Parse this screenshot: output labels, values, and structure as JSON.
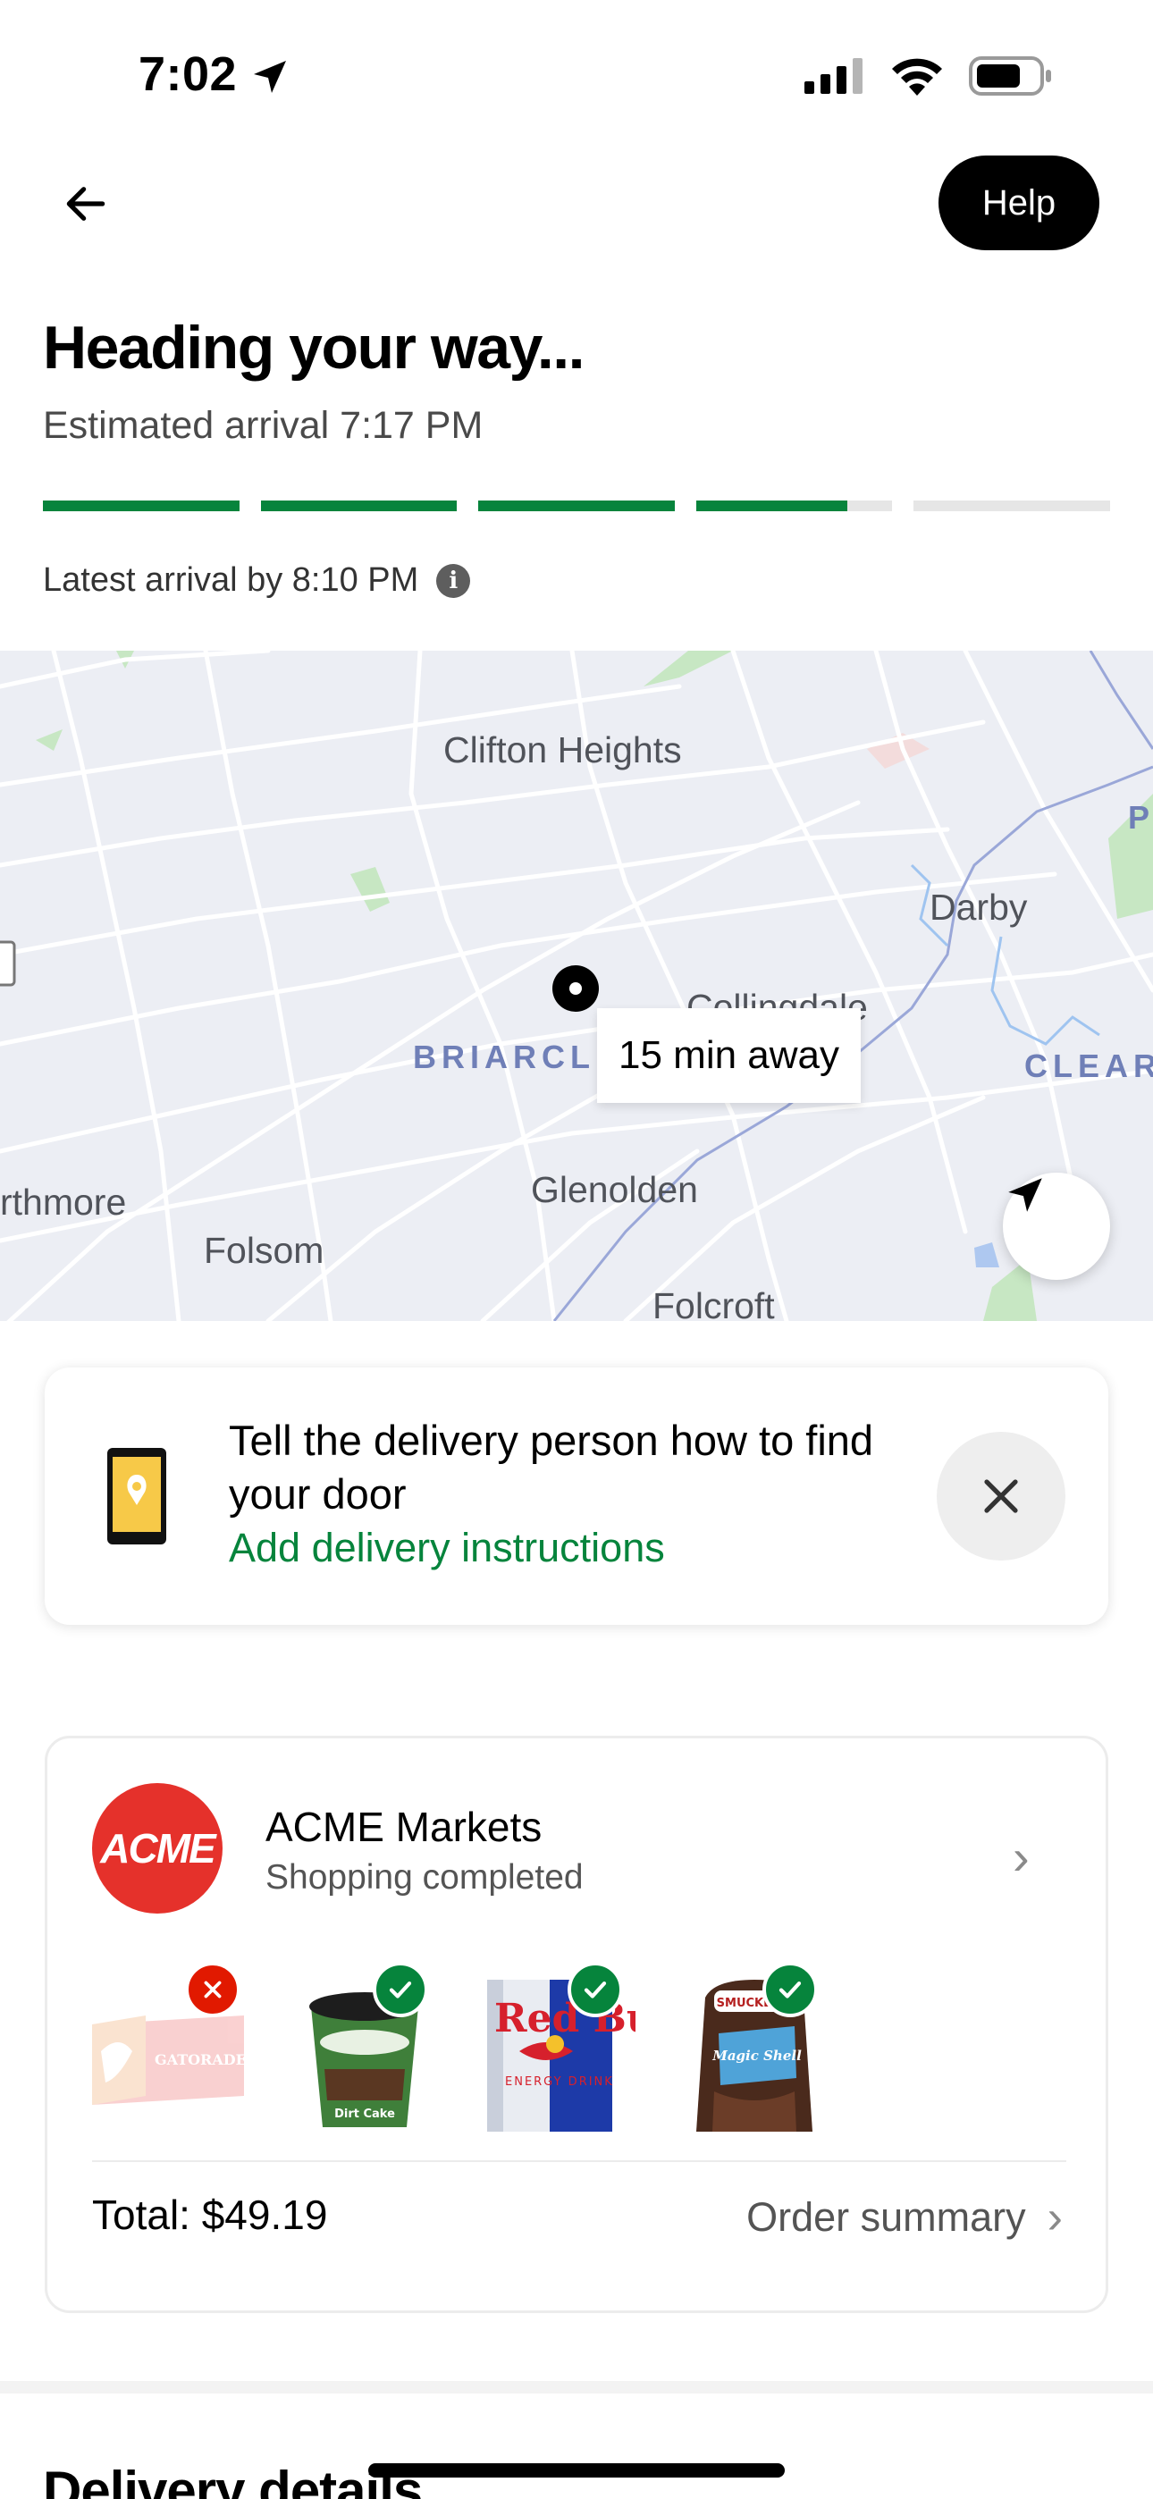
{
  "status_bar": {
    "time": "7:02"
  },
  "header": {
    "help_label": "Help"
  },
  "tracking": {
    "title": "Heading your way...",
    "eta": "Estimated arrival 7:17 PM",
    "latest": "Latest arrival by 8:10 PM",
    "progress_segments": [
      1,
      1,
      1,
      0.77,
      0
    ]
  },
  "map": {
    "labels": [
      "Clifton Heights",
      "Darby",
      "Collingdale",
      "BRIARCL",
      "CLEAR",
      "rthmore",
      "Glenolden",
      "Folsom",
      "Folcroft",
      "P"
    ],
    "eta_chip": "15 min away"
  },
  "instructions": {
    "title": "Tell the delivery person how to find your door",
    "link": "Add delivery instructions"
  },
  "store": {
    "logo_text": "ACME",
    "name": "ACME Markets",
    "status": "Shopping completed",
    "items": [
      {
        "name": "Gatorade",
        "status": "unavailable",
        "label": "GATORADE"
      },
      {
        "name": "Ben & Jerry's Dirt Cake",
        "status": "found",
        "label": "Dirt Cake"
      },
      {
        "name": "Red Bull",
        "status": "found",
        "label": "Red Bull"
      },
      {
        "name": "Smucker's Magic Shell Chocolate",
        "status": "found",
        "label": "Magic Shell"
      }
    ],
    "total": "Total: $49.19",
    "summary_label": "Order summary"
  },
  "delivery_details": {
    "heading": "Delivery details"
  },
  "colors": {
    "accent_green": "#06843c",
    "error_red": "#e11900",
    "acme_red": "#e5312b"
  }
}
